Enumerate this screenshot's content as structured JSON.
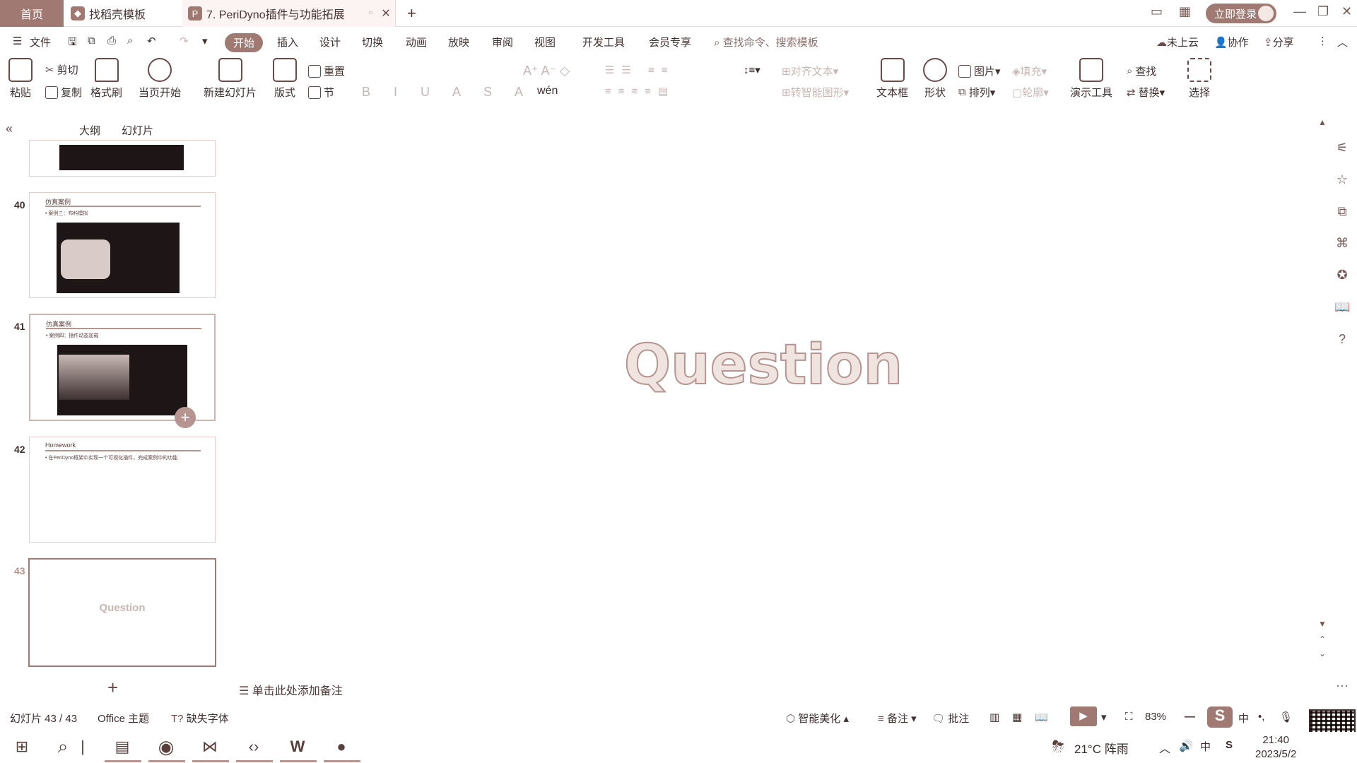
{
  "titlebar": {
    "home_tab": "首页",
    "template_tab": "找稻壳模板",
    "doc_tab": "7. PeriDyno插件与功能拓展",
    "new_tab": "+",
    "login": "立即登录"
  },
  "menu": {
    "file": "文件",
    "tabs": [
      "开始",
      "插入",
      "设计",
      "切换",
      "动画",
      "放映",
      "审阅",
      "视图",
      "开发工具",
      "会员专享"
    ],
    "search_placeholder": "查找命令、搜索模板",
    "cloud": "未上云",
    "collab": "协作",
    "share": "分享"
  },
  "ribbon": {
    "paste": "粘贴",
    "cut": "剪切",
    "copy": "复制",
    "format_painter": "格式刷",
    "from_current": "当页开始",
    "new_slide": "新建幻灯片",
    "layout": "版式",
    "section": "节",
    "reset": "重置",
    "align_text": "对齐文本",
    "smart_art": "转智能图形",
    "textbox": "文本框",
    "shape": "形状",
    "picture": "图片",
    "fill": "填充",
    "arrange": "排列",
    "outline": "轮廓",
    "present_tools": "演示工具",
    "find": "查找",
    "replace": "替换",
    "select": "选择"
  },
  "panel": {
    "outline_tab": "大纲",
    "slides_tab": "幻灯片",
    "slides": [
      {
        "num": "40",
        "title": "仿真案例",
        "sub": "• 案例三：布料模拟"
      },
      {
        "num": "41",
        "title": "仿真案例",
        "sub": "• 案例四：插件动态加载"
      },
      {
        "num": "42",
        "title": "Homework",
        "sub": "• 在PeriDyno框架中实现一个可视化插件，完成案例中的功能"
      },
      {
        "num": "43",
        "title": "Question",
        "sub": ""
      }
    ],
    "add_slide": "+"
  },
  "slide": {
    "main_text": "Question"
  },
  "notes": {
    "placeholder": "单击此处添加备注"
  },
  "status": {
    "slide_counter": "幻灯片 43 / 43",
    "theme": "Office 主题",
    "missing_font": "缺失字体",
    "beautify": "智能美化",
    "notes": "备注",
    "comment": "批注",
    "zoom": "83%"
  },
  "taskbar": {
    "weather": "21°C 阵雨",
    "time": "21:40",
    "date": "2023/5/2",
    "ime": "中"
  },
  "colors": {
    "accent": "#a07a72",
    "accent_light": "#f0e4e1",
    "text": "#3f2f2d"
  }
}
